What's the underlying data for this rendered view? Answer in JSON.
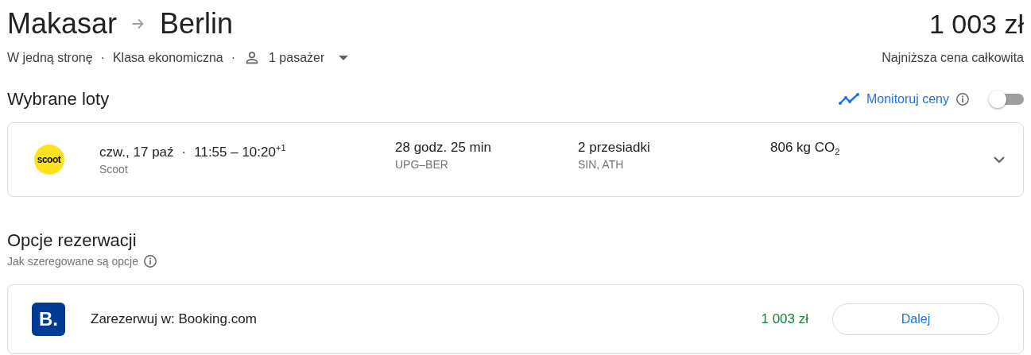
{
  "header": {
    "origin": "Makasar",
    "destination": "Berlin",
    "price": "1 003 zł",
    "price_note": "Najniższa cena całkowita"
  },
  "separator": "·",
  "trip_options": [
    {
      "kind": "text",
      "label": "W jedną stronę"
    },
    {
      "kind": "text",
      "label": "Klasa ekonomiczna"
    },
    {
      "kind": "passengers",
      "label": "1 pasażer"
    }
  ],
  "selected_flights": {
    "title": "Wybrane loty",
    "track_prices": {
      "label": "Monitoruj ceny",
      "on": false
    },
    "flights": [
      {
        "logo_text": "scoot",
        "date": "czw., 17 paź",
        "times": "11:55 – 10:20$^{+1}$",
        "airline": "Scoot",
        "duration": "28 godz. 25 min",
        "route": "UPG–BER",
        "stops": "2 przesiadki",
        "stop_airports": "SIN, ATH",
        "emissions": "806 kg CO$_{2}$",
        "expanded": false
      }
    ]
  },
  "booking_options": {
    "title": "Opcje rezerwacji",
    "subtitle": "Jak szeregowane są opcje",
    "options": [
      {
        "logo_text": "B.",
        "label": "Zarezerwuj w: Booking.com",
        "price": "1 003 zł",
        "button": "Dalej"
      }
    ]
  }
}
